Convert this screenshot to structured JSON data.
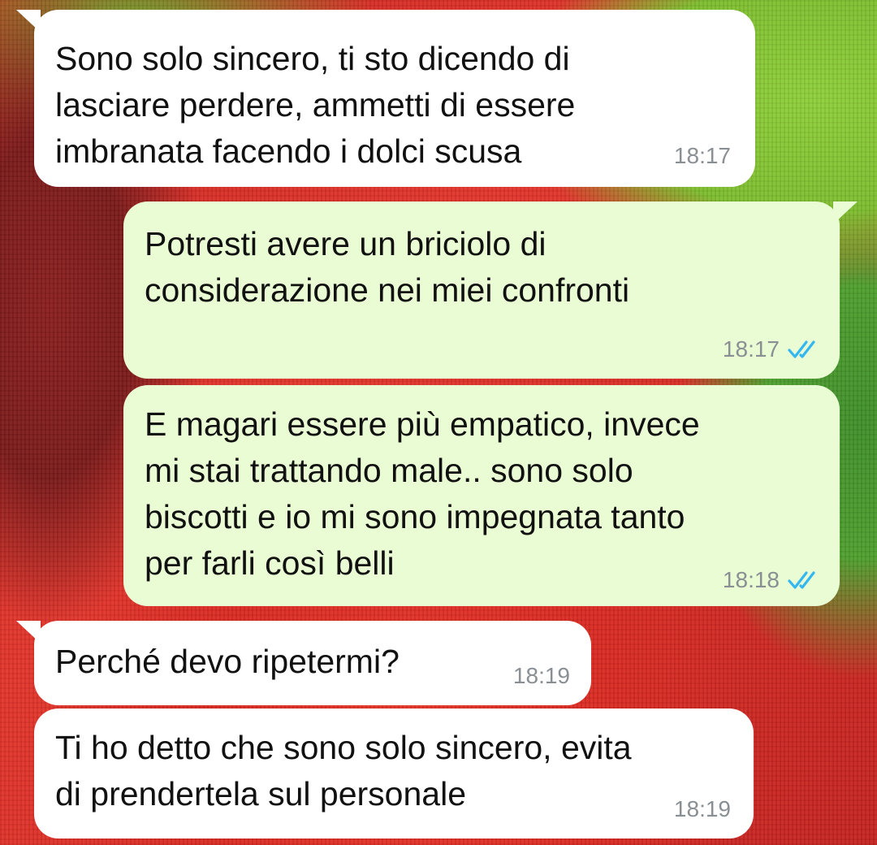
{
  "chat": {
    "messages": [
      {
        "direction": "incoming",
        "text": "Sono solo sincero, ti sto dicendo di\nlasciare perdere, ammetti di essere\nimbranata facendo i dolci scusa",
        "time": "18:17"
      },
      {
        "direction": "outgoing",
        "text": "Potresti avere un briciolo di\nconsiderazione nei miei confronti",
        "time": "18:17",
        "status": "read",
        "status_icon": "double-check-icon"
      },
      {
        "direction": "outgoing",
        "text": "E magari essere più empatico, invece\nmi stai trattando male.. sono solo\nbiscotti e io mi sono impegnata tanto\nper farli così belli",
        "time": "18:18",
        "status": "read",
        "status_icon": "double-check-icon"
      },
      {
        "direction": "incoming",
        "text": "Perché devo ripetermi?",
        "time": "18:19"
      },
      {
        "direction": "incoming",
        "text": "Ti ho detto che sono solo sincero, evita\ndi prendertela sul personale",
        "time": "18:19"
      }
    ]
  },
  "colors": {
    "incoming_bubble": "#ffffff",
    "outgoing_bubble": "#e9fcd4",
    "timestamp": "#8a8f94",
    "read_ticks": "#34b7f1",
    "wallpaper_red": "#d92a22",
    "wallpaper_green": "#7dbd2e"
  }
}
